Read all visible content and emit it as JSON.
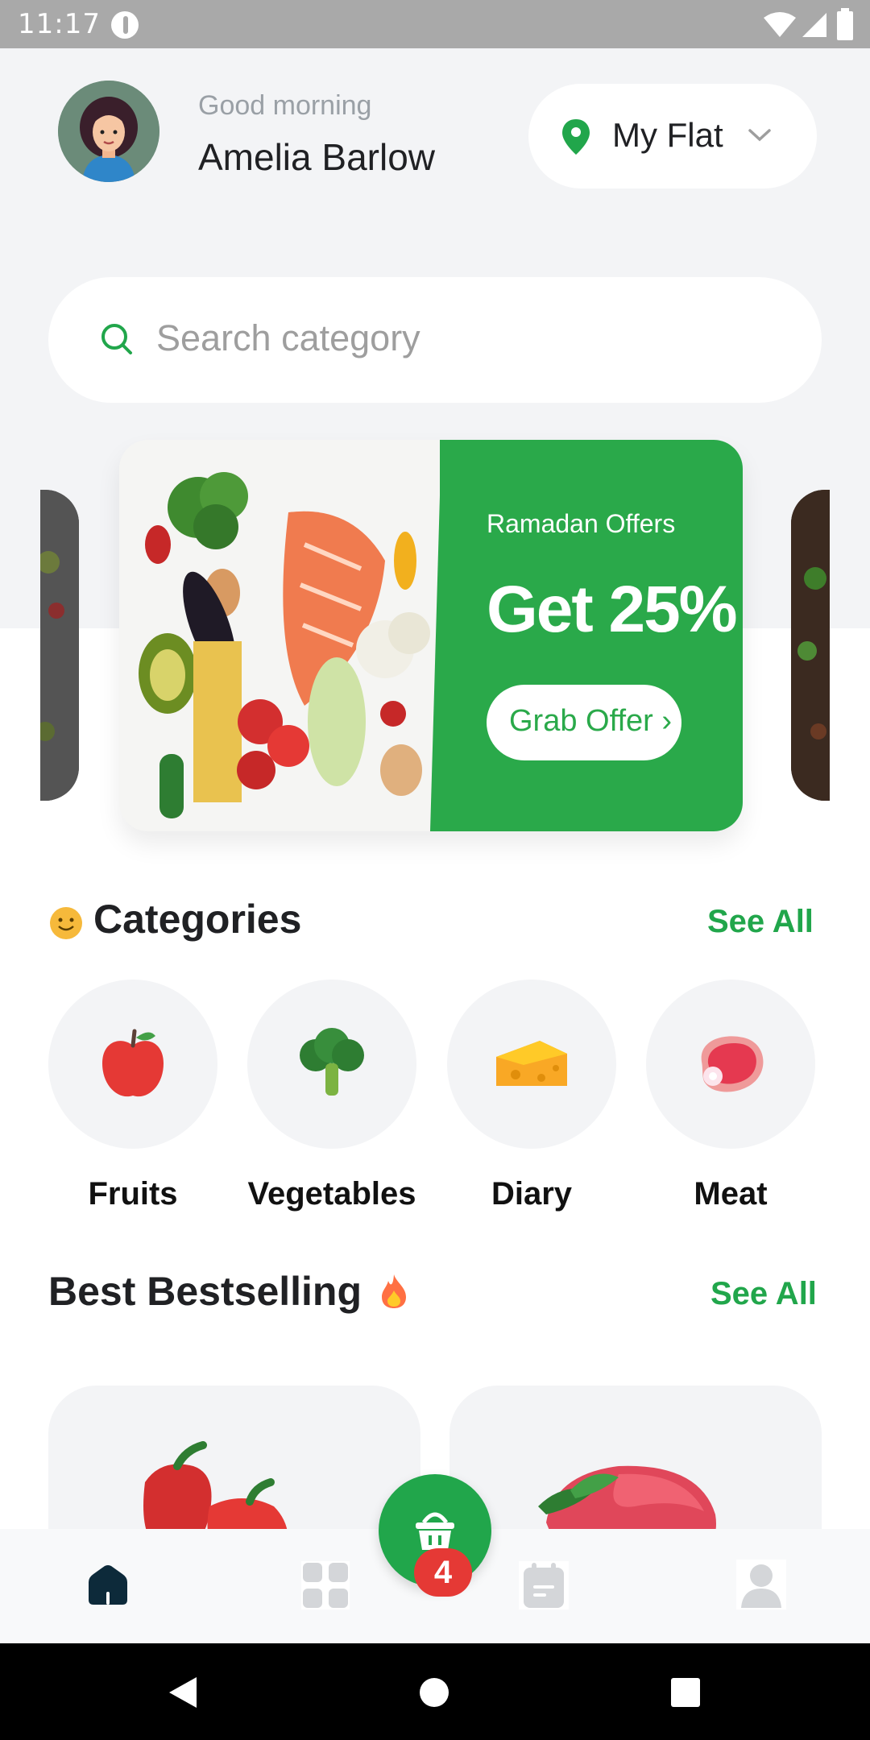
{
  "status_bar": {
    "time": "11:17"
  },
  "header": {
    "greeting": "Good morning",
    "user_name": "Amelia Barlow",
    "location": "My Flat"
  },
  "search": {
    "placeholder": "Search category"
  },
  "banner": {
    "tag": "Ramadan Offers",
    "title": "Get 25%",
    "button_label": "Grab Offer ›"
  },
  "categories": {
    "title": "Categories",
    "see_all": "See All",
    "items": [
      {
        "label": "Fruits",
        "icon": "apple-icon"
      },
      {
        "label": "Vegetables",
        "icon": "broccoli-icon"
      },
      {
        "label": "Diary",
        "icon": "cheese-icon"
      },
      {
        "label": "Meat",
        "icon": "meat-icon"
      }
    ]
  },
  "bestselling": {
    "title": "Best Bestselling",
    "see_all": "See All",
    "products": [
      {
        "icon": "bell-pepper-image"
      },
      {
        "icon": "beef-image"
      }
    ]
  },
  "bottom_nav": {
    "items": [
      "home-icon",
      "grid-icon",
      "cart-icon",
      "orders-icon",
      "profile-icon"
    ],
    "cart_count": "4",
    "accent": "#21a64b"
  }
}
